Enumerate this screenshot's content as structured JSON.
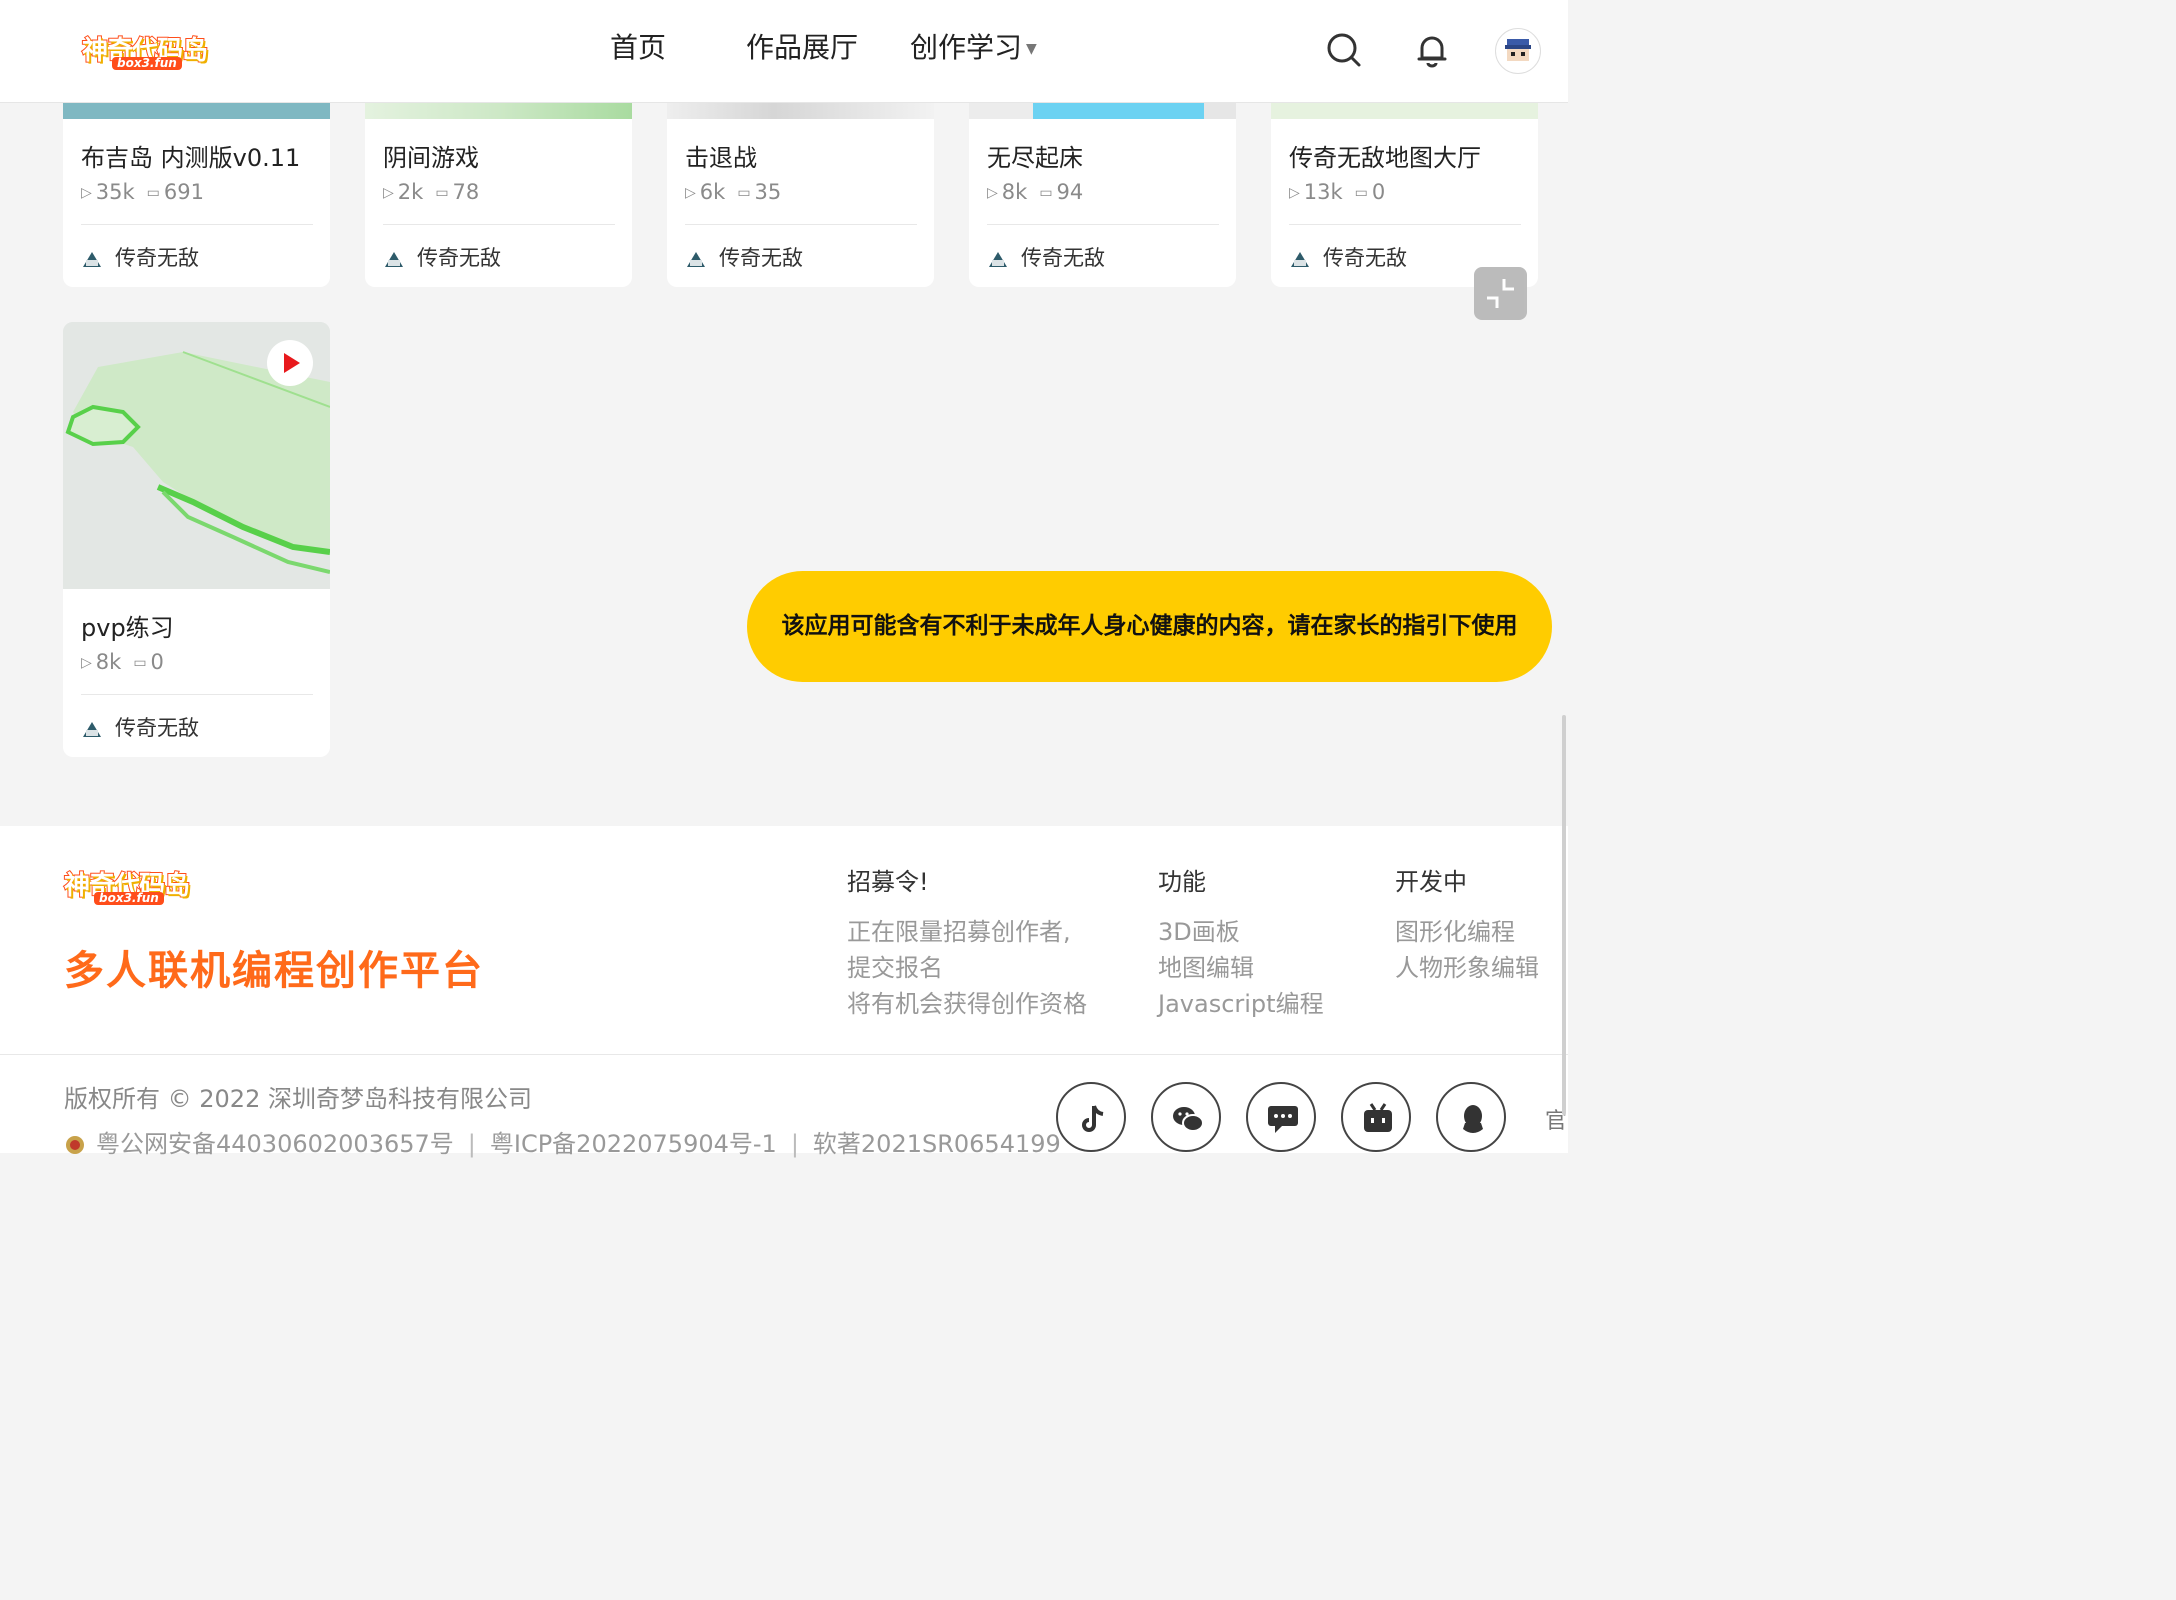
{
  "header": {
    "logo": {
      "title": "神奇代码岛",
      "sub": "box3.fun"
    },
    "nav": [
      {
        "label": "首页"
      },
      {
        "label": "作品展厅"
      },
      {
        "label": "创作学习"
      }
    ]
  },
  "cards_row1": [
    {
      "title": "布吉岛 内测版v0.11",
      "plays": "35k",
      "comments": "691",
      "author": "传奇无敌"
    },
    {
      "title": "阴间游戏",
      "plays": "2k",
      "comments": "78",
      "author": "传奇无敌"
    },
    {
      "title": "击退战",
      "plays": "6k",
      "comments": "35",
      "author": "传奇无敌"
    },
    {
      "title": "无尽起床",
      "plays": "8k",
      "comments": "94",
      "author": "传奇无敌"
    },
    {
      "title": "传奇无敌地图大厅",
      "plays": "13k",
      "comments": "0",
      "author": "传奇无敌"
    }
  ],
  "card_row2": {
    "title": "pvp练习",
    "plays": "8k",
    "comments": "0",
    "author": "传奇无敌"
  },
  "warning": "该应用可能含有不利于未成年人身心健康的内容，请在家长的指引下使用",
  "footer": {
    "logo": {
      "title": "神奇代码岛",
      "sub": "box3.fun"
    },
    "slogan": "多人联机编程创作平台",
    "cols": [
      {
        "head": "招募令!",
        "items": [
          "正在限量招募创作者,",
          "提交报名",
          "将有机会获得创作资格"
        ]
      },
      {
        "head": "功能",
        "items": [
          "3D画板",
          "地图编辑",
          "Javascript编程"
        ]
      },
      {
        "head": "开发中",
        "items": [
          "图形化编程",
          "人物形象编辑"
        ]
      }
    ],
    "copyright": "版权所有 © 2022 深圳奇梦岛科技有限公司",
    "records": [
      "粤公网安备44030602003657号",
      "粤ICP备2022075904号-1",
      "软著2021SR0654199"
    ],
    "cutoff": "官"
  },
  "colors": {
    "accent": "#ff6a1a",
    "warning": "#ffcc00",
    "play": "#e8191c"
  }
}
